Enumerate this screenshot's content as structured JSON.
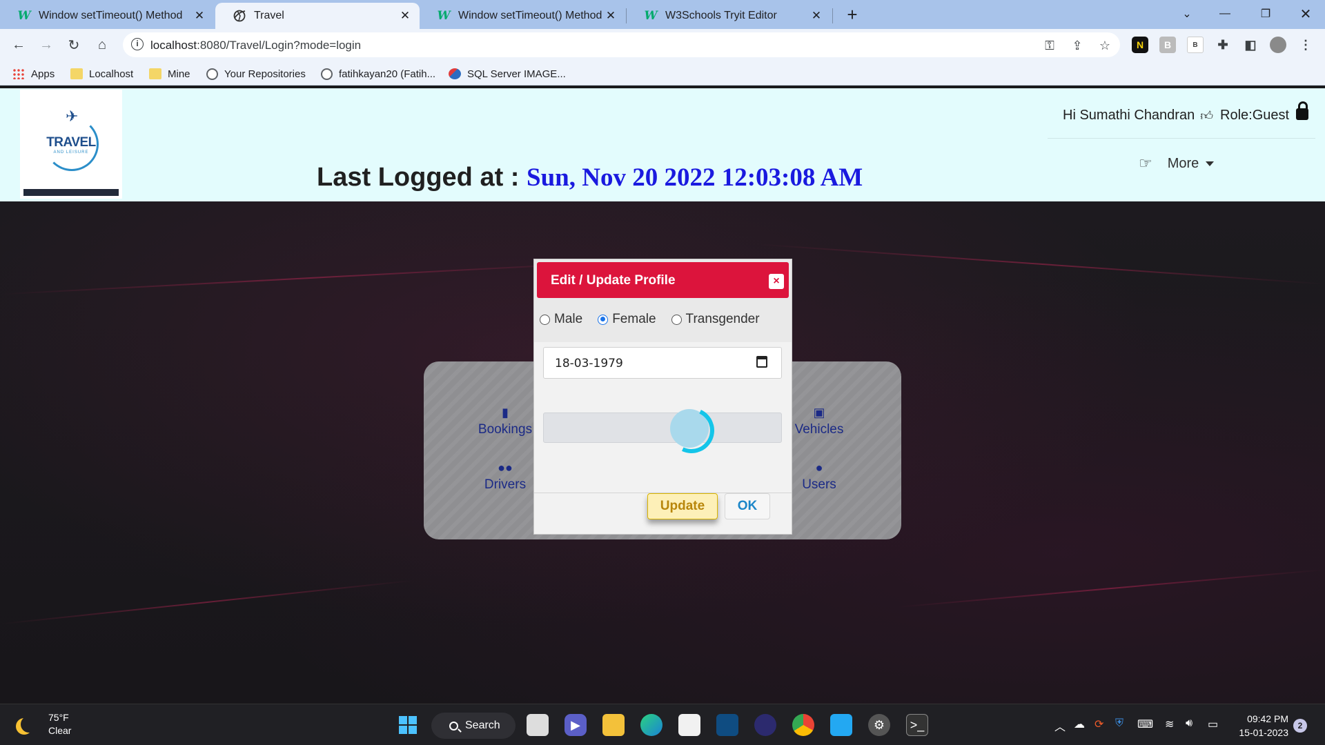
{
  "browser": {
    "tabs": [
      {
        "title": "Window setTimeout() Method",
        "favicon": "w3schools-icon"
      },
      {
        "title": "Travel",
        "favicon": "travel-globe-icon",
        "active": true
      },
      {
        "title": "Window setTimeout() Method",
        "favicon": "w3schools-icon"
      },
      {
        "title": "W3Schools Tryit Editor",
        "favicon": "w3schools-icon"
      }
    ],
    "url": {
      "host": "localhost",
      "rest": ":8080/Travel/Login?mode=login"
    },
    "bookmarks": [
      "Apps",
      "Localhost",
      "Mine",
      "Your Repositories",
      "fatihkayan20 (Fatih...",
      "SQL Server IMAGE..."
    ]
  },
  "header": {
    "logo": {
      "word": "TRAVEL",
      "sub": "AND LEISURE"
    },
    "last_logged_label": "Last Logged at :",
    "last_logged_value": "Sun, Nov 20 2022 12:03:08 AM",
    "greeting": "Hi Sumathi Chandran",
    "role": "Role:Guest",
    "more_label": "More"
  },
  "dashboard": {
    "items": [
      "Bookings",
      "Drivers",
      "Vehicles",
      "Users"
    ]
  },
  "modal": {
    "title": "Edit / Update Profile",
    "close_glyph": "×",
    "gender_options": [
      "Male",
      "Female",
      "Transgender"
    ],
    "selected_gender": "Female",
    "dob": "18-03-1979",
    "update_label": "Update",
    "ok_label": "OK"
  },
  "taskbar": {
    "weather_temp": "75°F",
    "weather_desc": "Clear",
    "search_label": "Search",
    "time": "09:42 PM",
    "date": "15-01-2023",
    "notifications": "2"
  },
  "colors": {
    "tabbar": "#a8c3ea",
    "header_bg": "#e3fcfd",
    "modal_header": "#dc143c",
    "timestamp": "#1a1adf",
    "dashboard_text": "#1b2a86"
  }
}
